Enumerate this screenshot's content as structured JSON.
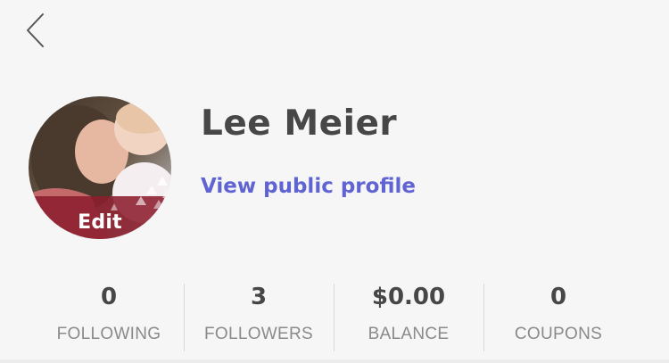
{
  "nav": {
    "back_icon": "chevron-left-icon"
  },
  "profile": {
    "name": "Lee Meier",
    "public_link": "View public profile",
    "avatar_edit_label": "Edit",
    "colors": {
      "name": "#474747",
      "link": "#6064d2",
      "edit_overlay": "#8c1e2d"
    }
  },
  "stats": [
    {
      "value": "0",
      "label": "FOLLOWING"
    },
    {
      "value": "3",
      "label": "FOLLOWERS"
    },
    {
      "value": "$0.00",
      "label": "BALANCE"
    },
    {
      "value": "0",
      "label": "COUPONS"
    }
  ]
}
